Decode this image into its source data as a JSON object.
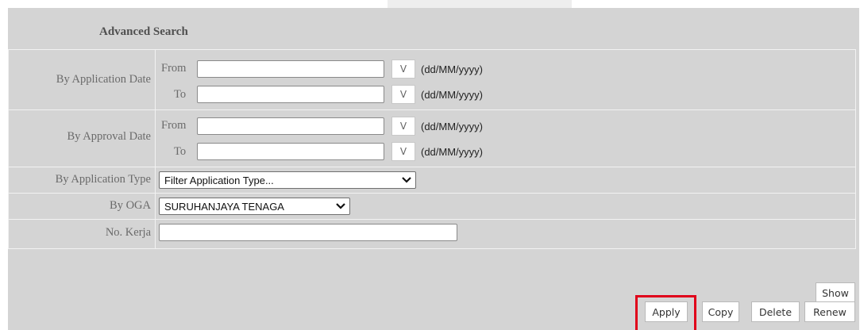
{
  "form": {
    "title": "Advanced Search",
    "application_date": {
      "label": "By Application Date",
      "from_label": "From",
      "to_label": "To",
      "from_value": "",
      "to_value": "",
      "picker_label": "V",
      "format_hint": "(dd/MM/yyyy)"
    },
    "approval_date": {
      "label": "By Approval Date",
      "from_label": "From",
      "to_label": "To",
      "from_value": "",
      "to_value": "",
      "picker_label": "V",
      "format_hint": "(dd/MM/yyyy)"
    },
    "application_type": {
      "label": "By Application Type",
      "selected": "Filter Application Type..."
    },
    "oga": {
      "label": "By OGA",
      "selected": "SURUHANJAYA TENAGA"
    },
    "no_kerja": {
      "label": "No. Kerja",
      "value": ""
    }
  },
  "buttons": {
    "show": "Show",
    "apply": "Apply",
    "copy": "Copy",
    "delete": "Delete",
    "renew": "Renew"
  },
  "colors": {
    "panel": "#d4d4d4",
    "highlight": "#e0001a"
  }
}
